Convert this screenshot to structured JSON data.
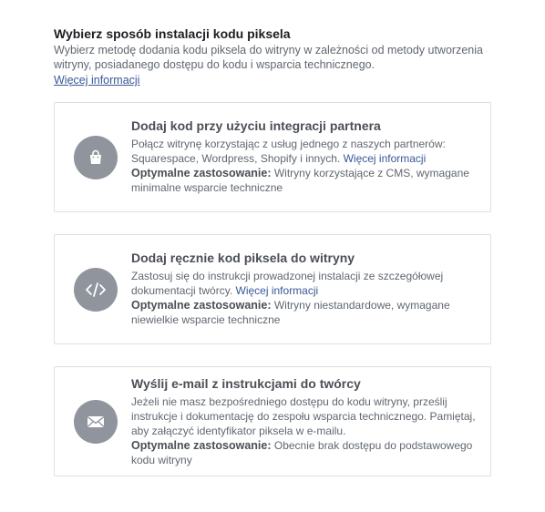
{
  "header": {
    "title": "Wybierz sposób instalacji kodu piksela",
    "description": "Wybierz metodę dodania kodu piksela do witryny w zależności od metody utworzenia witryny, posiadanego dostępu do kodu i wsparcia technicznego.",
    "link": "Więcej informacji"
  },
  "options": [
    {
      "icon": "shopping-bag-icon",
      "title": "Dodaj kod przy użyciu integracji partnera",
      "description": "Połącz witrynę korzystając z usług jednego z naszych partnerów: Squarespace, Wordpress, Shopify i innych.",
      "link": "Więcej informacji",
      "best_label": "Optymalne zastosowanie:",
      "best_text": "Witryny korzystające z CMS, wymagane minimalne wsparcie techniczne"
    },
    {
      "icon": "code-icon",
      "title": "Dodaj ręcznie kod piksela do witryny",
      "description": "Zastosuj się do instrukcji prowadzonej instalacji ze szczegółowej dokumentacji twórcy.",
      "link": "Więcej informacji",
      "best_label": "Optymalne zastosowanie:",
      "best_text": "Witryny niestandardowe, wymagane niewielkie wsparcie techniczne"
    },
    {
      "icon": "envelope-icon",
      "title": "Wyślij e-mail z instrukcjami do twórcy",
      "description": "Jeżeli nie masz bezpośredniego dostępu do kodu witryny, prześlij instrukcje i dokumentację do zespołu wsparcia technicznego. Pamiętaj, aby załączyć identyfikator piksela w e-mailu.",
      "best_label": "Optymalne zastosowanie:",
      "best_text": "Obecnie brak dostępu do podstawowego kodu witryny"
    }
  ]
}
